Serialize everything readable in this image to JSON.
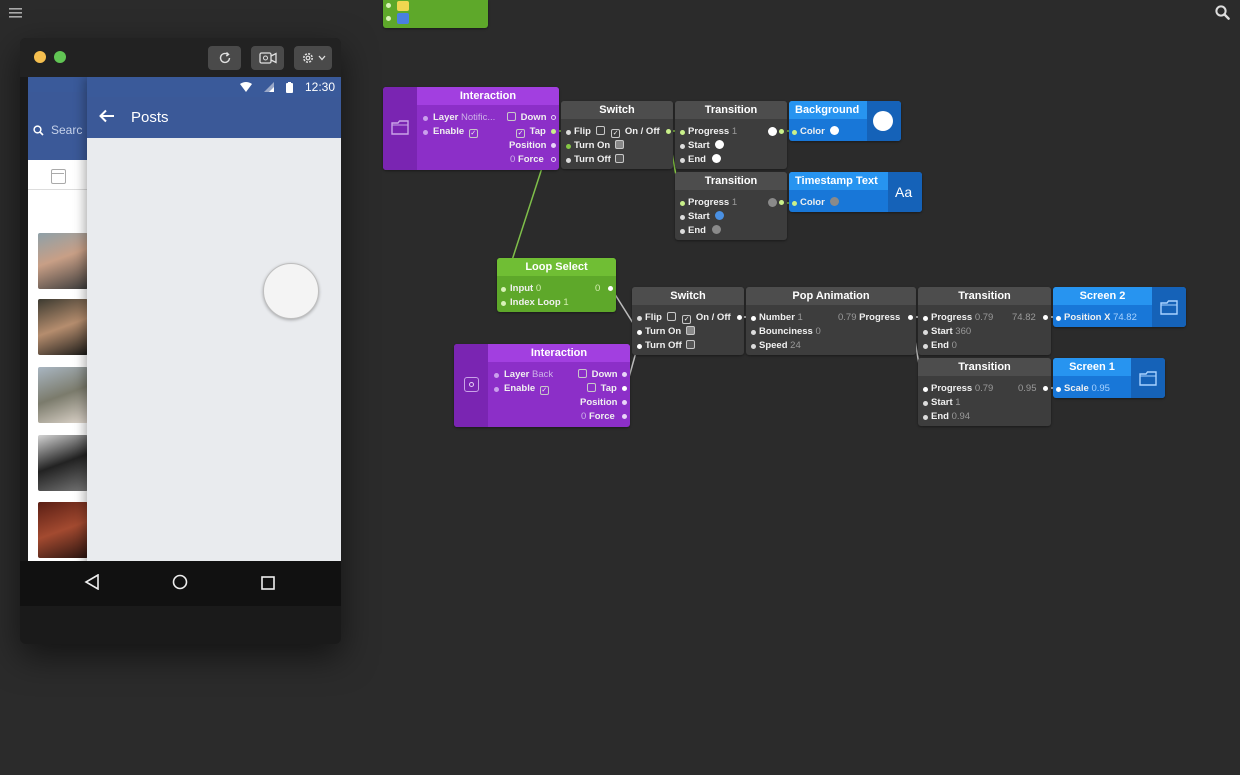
{
  "canvas": {
    "menu_icon": "hamburger-icon",
    "search_icon": "search-icon"
  },
  "preview": {
    "toolbar": {
      "refresh_icon": "refresh-icon",
      "record_icon": "video-icon",
      "settings_icon": "gear-icon"
    },
    "back_layer": {
      "search_placeholder": "Searc"
    },
    "status_bar": {
      "time": "12:30"
    },
    "app_bar": {
      "title": "Posts"
    }
  },
  "nodes": {
    "interaction_notif": {
      "title": "Interaction",
      "layer_label": "Layer",
      "layer_value": "Notific...",
      "enable_label": "Enable",
      "down_label": "Down",
      "tap_label": "Tap",
      "position_label": "Position",
      "force_label": "Force",
      "force_value": "0"
    },
    "switch_top": {
      "title": "Switch",
      "flip_label": "Flip",
      "onoff_label": "On / Off",
      "turn_on_label": "Turn On",
      "turn_off_label": "Turn Off"
    },
    "transition_bg": {
      "title": "Transition",
      "progress_label": "Progress",
      "progress_value": "1",
      "start_label": "Start",
      "end_label": "End"
    },
    "background": {
      "title": "Background",
      "color_label": "Color"
    },
    "transition_ts": {
      "title": "Transition",
      "progress_label": "Progress",
      "progress_value": "1",
      "start_label": "Start",
      "end_label": "End"
    },
    "timestamp_text": {
      "title": "Timestamp Text",
      "color_label": "Color",
      "glyph": "Aa"
    },
    "loop_select": {
      "title": "Loop Select",
      "input_label": "Input",
      "input_value": "0",
      "output_value": "0",
      "index_loop_label": "Index Loop",
      "index_loop_value": "1"
    },
    "switch_mid": {
      "title": "Switch",
      "flip_label": "Flip",
      "onoff_label": "On / Off",
      "turn_on_label": "Turn On",
      "turn_off_label": "Turn Off"
    },
    "pop_animation": {
      "title": "Pop Animation",
      "number_label": "Number",
      "number_value": "1",
      "bounciness_label": "Bounciness",
      "bounciness_value": "0",
      "speed_label": "Speed",
      "speed_value": "24",
      "progress_out_value": "0.79",
      "progress_out_label": "Progress"
    },
    "transition_pos": {
      "title": "Transition",
      "progress_label": "Progress",
      "progress_value": "0.79",
      "out_value": "74.82",
      "start_label": "Start",
      "start_value": "360",
      "end_label": "End",
      "end_value": "0"
    },
    "screen2": {
      "title": "Screen 2",
      "position_label": "Position X",
      "position_value": "74.82"
    },
    "interaction_back": {
      "title": "Interaction",
      "layer_label": "Layer",
      "layer_value": "Back",
      "enable_label": "Enable",
      "down_label": "Down",
      "tap_label": "Tap",
      "position_label": "Position",
      "force_label": "Force",
      "force_value": "0"
    },
    "transition_scale": {
      "title": "Transition",
      "progress_label": "Progress",
      "progress_value": "0.79",
      "out_value": "0.95",
      "start_label": "Start",
      "start_value": "1",
      "end_label": "End",
      "end_value": "0.94"
    },
    "screen1": {
      "title": "Screen 1",
      "scale_label": "Scale",
      "scale_value": "0.95"
    }
  }
}
